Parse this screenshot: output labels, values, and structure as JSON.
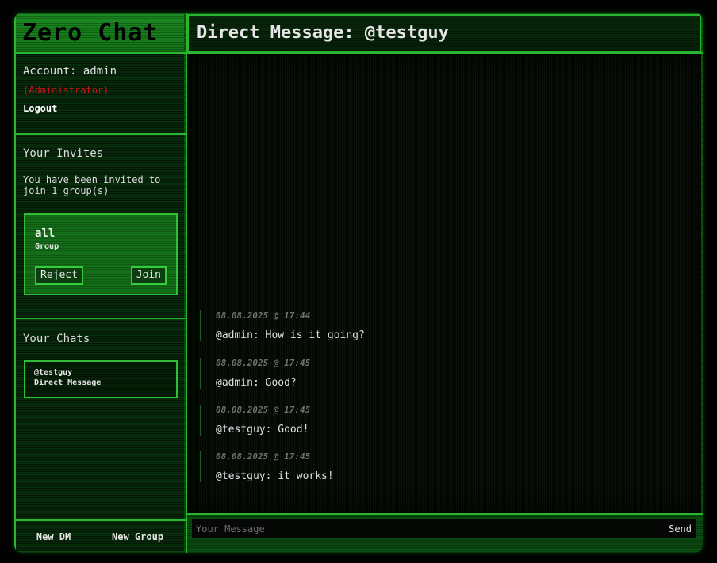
{
  "app": {
    "brand": "Zero Chat"
  },
  "header": {
    "title": "Direct Message: @testguy"
  },
  "account": {
    "label": "Account: admin",
    "role": "(Administrator)",
    "logout": "Logout"
  },
  "invites": {
    "title": "Your Invites",
    "text": "You have been invited to join 1 group(s)",
    "items": [
      {
        "name": "all",
        "type": "Group",
        "reject": "Reject",
        "join": "Join"
      }
    ]
  },
  "chats": {
    "title": "Your Chats",
    "items": [
      {
        "name": "@testguy",
        "type": "Direct Message"
      }
    ]
  },
  "bottom": {
    "new_dm": "New DM",
    "new_group": "New Group"
  },
  "messages": [
    {
      "timestamp": "08.08.2025 @ 17:44",
      "text": "@admin: How is it going?"
    },
    {
      "timestamp": "08.08.2025 @ 17:45",
      "text": "@admin: Good?"
    },
    {
      "timestamp": "08.08.2025 @ 17:45",
      "text": "@testguy: Good!"
    },
    {
      "timestamp": "08.08.2025 @ 17:45",
      "text": "@testguy: it works!"
    }
  ],
  "composer": {
    "placeholder": "Your Message",
    "value": "",
    "send": "Send"
  },
  "colors": {
    "accent": "#27b62e",
    "panel": "#072a0a",
    "admin_role": "#c8161b"
  }
}
